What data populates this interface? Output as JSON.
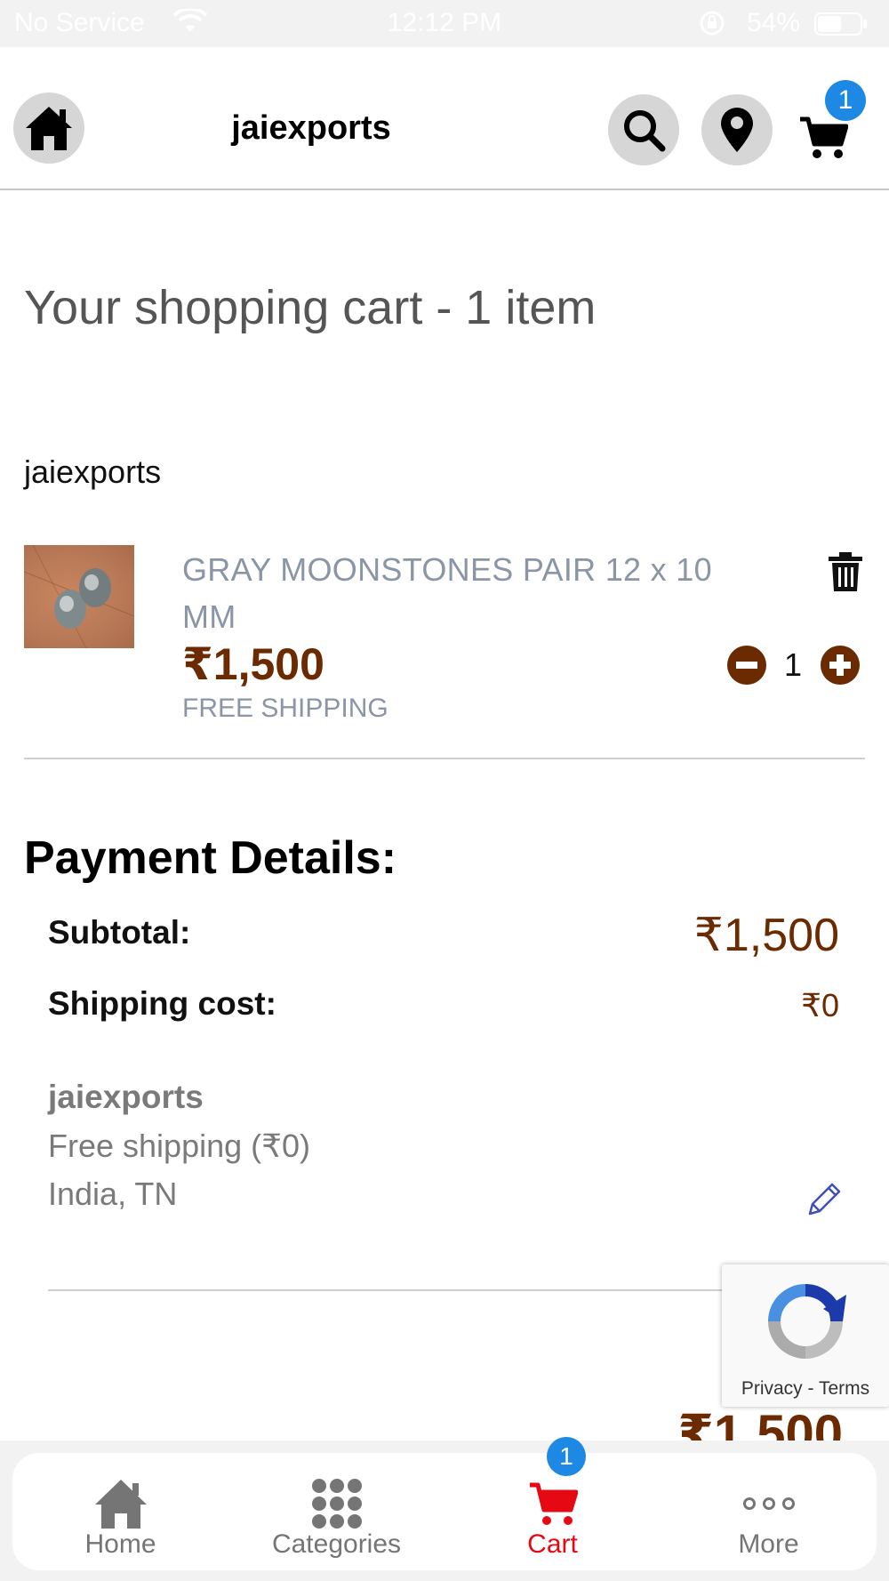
{
  "status_bar": {
    "carrier": "No Service",
    "time": "12:12 PM",
    "battery": "54%"
  },
  "header": {
    "title": "jaiexports",
    "cart_count": "1",
    "icons": [
      "home-icon",
      "search-icon",
      "location-pin-icon",
      "cart-icon"
    ]
  },
  "page": {
    "heading": "Your shopping cart - 1 item",
    "store": "jaiexports"
  },
  "cart_item": {
    "name": "GRAY MOONSTONES PAIR 12 x 10 MM",
    "price": "₹1,500",
    "shipping": "FREE SHIPPING",
    "quantity": "1"
  },
  "payment": {
    "heading": "Payment Details:",
    "subtotal_label": "Subtotal:",
    "subtotal_value": "₹1,500",
    "shipping_label": "Shipping cost:",
    "shipping_value": "₹0",
    "ship_store": "jaiexports",
    "ship_method": "Free shipping (₹0)",
    "ship_location": "India, TN",
    "total_partial": "₹1,500"
  },
  "recaptcha": {
    "privacy": "Privacy",
    "separator": " - ",
    "terms": "Terms"
  },
  "tabbar": {
    "items": [
      {
        "label": "Home",
        "icon": "home-icon"
      },
      {
        "label": "Categories",
        "icon": "grid-icon"
      },
      {
        "label": "Cart",
        "icon": "cart-icon",
        "badge": "1"
      },
      {
        "label": "More",
        "icon": "more-dots-icon"
      }
    ]
  },
  "colors": {
    "price": "#6b2a00",
    "badge": "#1e88e5",
    "active_tab": "#e50914",
    "muted_text": "#8a95a6"
  }
}
